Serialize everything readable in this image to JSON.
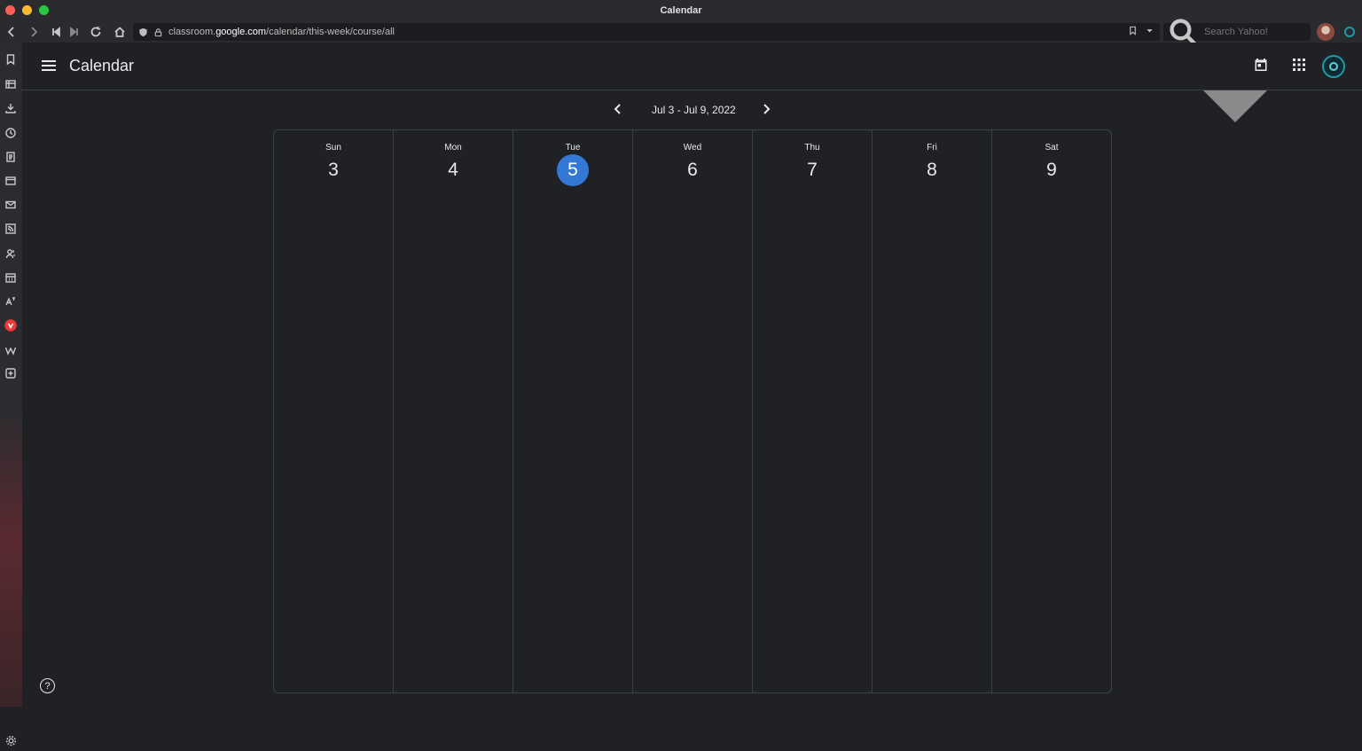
{
  "window": {
    "title": "Calendar"
  },
  "browser": {
    "url_prefix": "classroom.",
    "url_domain": "google.com",
    "url_path": "/calendar/this-week/course/all",
    "search_placeholder": "Search Yahoo!"
  },
  "app": {
    "title": "Calendar"
  },
  "week": {
    "range": "Jul 3 - Jul 9, 2022",
    "days": [
      {
        "name": "Sun",
        "num": "3",
        "today": false
      },
      {
        "name": "Mon",
        "num": "4",
        "today": false
      },
      {
        "name": "Tue",
        "num": "5",
        "today": true
      },
      {
        "name": "Wed",
        "num": "6",
        "today": false
      },
      {
        "name": "Thu",
        "num": "7",
        "today": false
      },
      {
        "name": "Fri",
        "num": "8",
        "today": false
      },
      {
        "name": "Sat",
        "num": "9",
        "today": false
      }
    ]
  },
  "help": {
    "label": "?"
  },
  "colors": {
    "accent": "#3478d5",
    "background": "#202124",
    "border": "#3c4043"
  }
}
